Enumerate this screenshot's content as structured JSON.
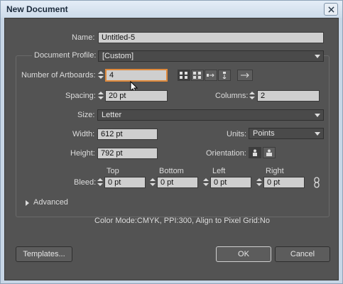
{
  "window": {
    "title": "New Document"
  },
  "name": {
    "label": "Name:",
    "value": "Untitled-5"
  },
  "profile": {
    "label": "Document Profile:",
    "value": "[Custom]"
  },
  "artboards": {
    "label": "Number of Artboards:",
    "value": "4",
    "layout_icons": [
      "grid-by-row-icon",
      "grid-by-column-icon",
      "arrange-by-row-icon",
      "arrange-by-column-icon"
    ],
    "direction_icon": "right-to-left-layout-icon"
  },
  "spacing": {
    "label": "Spacing:",
    "value": "20 pt"
  },
  "columns": {
    "label": "Columns:",
    "value": "2"
  },
  "size": {
    "label": "Size:",
    "value": "Letter"
  },
  "width": {
    "label": "Width:",
    "value": "612 pt"
  },
  "units": {
    "label": "Units:",
    "value": "Points"
  },
  "height": {
    "label": "Height:",
    "value": "792 pt"
  },
  "orientation": {
    "label": "Orientation:",
    "options": [
      "portrait-icon",
      "landscape-icon"
    ]
  },
  "bleed": {
    "label": "Bleed:",
    "top": {
      "label": "Top",
      "value": "0 pt"
    },
    "bottom": {
      "label": "Bottom",
      "value": "0 pt"
    },
    "left": {
      "label": "Left",
      "value": "0 pt"
    },
    "right": {
      "label": "Right",
      "value": "0 pt"
    },
    "link_icon": "chain-link-icon"
  },
  "advanced": {
    "label": "Advanced"
  },
  "summary": "Color Mode:CMYK, PPI:300, Align to Pixel Grid:No",
  "buttons": {
    "templates": "Templates...",
    "ok": "OK",
    "cancel": "Cancel"
  },
  "colors": {
    "panel": "#535353",
    "field": "#cfcfcf",
    "focus": "#e08a3c"
  }
}
